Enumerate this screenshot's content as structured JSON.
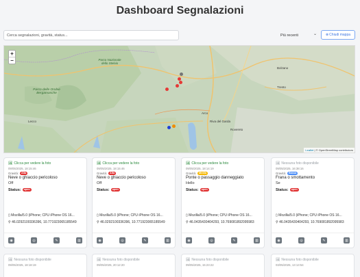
{
  "header": {
    "title": "Dashboard Segnalazioni"
  },
  "filters": {
    "search_placeholder": "Cerca segnalazioni, gravità, status...",
    "sort_label": "Più recenti",
    "map_button_label": "Chiudi mappa"
  },
  "map": {
    "zoom_in": "+",
    "zoom_out": "−",
    "labels": {
      "parco_orobie": "Parco delle Orobie Bergamasche",
      "parco_stelvio": "Parco Nazionale dello Stelvio",
      "arco": "Arco",
      "rovereto": "Rovereto",
      "bolzano": "Bolzano",
      "trento": "Trento",
      "lecco": "Lecco",
      "riva": "Riva del Garda"
    },
    "attribution_leaflet": "Leaflet",
    "attribution_osm": "| © OpenStreetMap contributors",
    "marker_colors": [
      "#e53935",
      "#e53935",
      "#e53935",
      "#e53935",
      "#757575",
      "#1e40d8",
      "#f08c00"
    ]
  },
  "cards": [
    {
      "photo_text": "Clicca per vedere la foto",
      "has_photo": true,
      "date": "09/05/2025, 18:15:46",
      "gravita_label": "Gravità:",
      "gravita": "Alta",
      "gravita_color": "#e03131",
      "title": "Neve o ghiaccio pericoloso",
      "description": "Off",
      "status_label": "Status:",
      "status": "open",
      "device": "Mozilla/5.0 (iPhone; CPU iPhone OS 16...",
      "coords": "46.0292100336396, 10.7719230651855​49"
    },
    {
      "photo_text": "Clicca per vedere la foto",
      "has_photo": true,
      "date": "09/05/2025, 18:15:46",
      "gravita_label": "Gravità:",
      "gravita": "Alta",
      "gravita_color": "#e03131",
      "title": "Neve o ghiaccio pericoloso",
      "description": "Off",
      "status_label": "Status:",
      "status": "open",
      "device": "Mozilla/5.0 (iPhone; CPU iPhone OS 16...",
      "coords": "46.0292100336396, 10.771923065185549"
    },
    {
      "photo_text": "Clicca per vedere la foto",
      "has_photo": true,
      "date": "09/05/2025, 18:14:19",
      "gravita_label": "Gravità:",
      "gravita": "Media",
      "gravita_color": "#f5b700",
      "title": "Ponte o passaggio danneggiato",
      "description": "Hello",
      "status_label": "Status:",
      "status": "open",
      "device": "Mozilla/5.0 (iPhone; CPU iPhone OS 16...",
      "coords": "46.0435430404293, 10.769081892095983"
    },
    {
      "photo_text": "Nessuna foto disponibile",
      "has_photo": false,
      "date": "09/05/2025, 16:38:16",
      "gravita_label": "Gravità:",
      "gravita": "Bassa",
      "gravita_color": "#4c8df6",
      "title": "Frana o smottamento",
      "description": "Se",
      "status_label": "Status:",
      "status": "open",
      "device": "Mozilla/5.0 (iPhone; CPU iPhone OS 16...",
      "coords": "46.0435430404293, 10.769081892095983"
    }
  ],
  "cards_row2": [
    {
      "photo_text": "Nessuna foto disponibile",
      "date": "09/05/2025, 18:18:19"
    },
    {
      "photo_text": "Nessuna foto disponibile",
      "date": "09/05/2025, 20:12:20"
    },
    {
      "photo_text": "Nessuna foto disponibile",
      "date": "09/05/2025, 15:23:22"
    },
    {
      "photo_text": "Nessuna foto disponibile",
      "date": "03/05/2025, 13:13:54"
    }
  ]
}
